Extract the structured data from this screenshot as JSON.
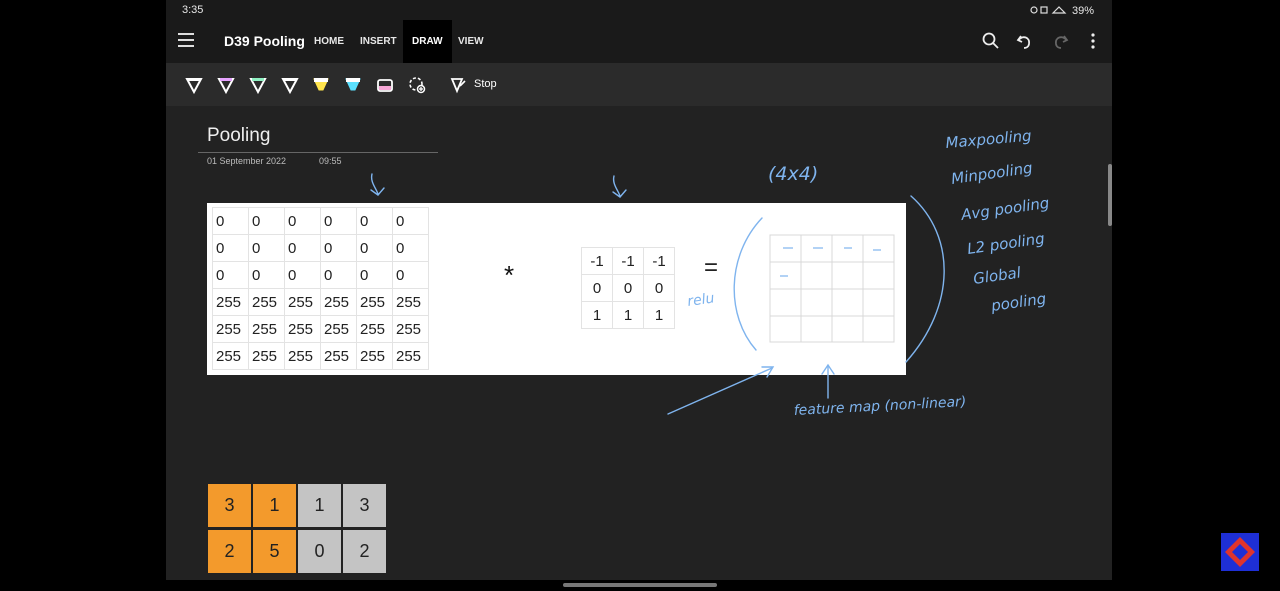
{
  "status_bar": {
    "time": "3:35",
    "battery": "39%"
  },
  "app_bar": {
    "notebook_title": "D39 Pooling",
    "tabs": [
      {
        "label": "HOME"
      },
      {
        "label": "INSERT"
      },
      {
        "label": "DRAW"
      },
      {
        "label": "VIEW"
      }
    ],
    "active_tab": "DRAW"
  },
  "ribbon": {
    "pen_colors": [
      "#ffffff",
      "#e6a3ff",
      "#8ff0c2",
      "#ffffff",
      "#ffe44d",
      "#5ce1ff",
      "#f6a6d6"
    ],
    "stop_label": "Stop"
  },
  "page": {
    "title": "Pooling",
    "date": "01 September 2022",
    "time": "09:55"
  },
  "image_matrix": [
    [
      "0",
      "0",
      "0",
      "0",
      "0",
      "0"
    ],
    [
      "0",
      "0",
      "0",
      "0",
      "0",
      "0"
    ],
    [
      "0",
      "0",
      "0",
      "0",
      "0",
      "0"
    ],
    [
      "255",
      "255",
      "255",
      "255",
      "255",
      "255"
    ],
    [
      "255",
      "255",
      "255",
      "255",
      "255",
      "255"
    ],
    [
      "255",
      "255",
      "255",
      "255",
      "255",
      "255"
    ]
  ],
  "operator": "*",
  "kernel": [
    [
      "-1",
      "-1",
      "-1"
    ],
    [
      "0",
      "0",
      "0"
    ],
    [
      "1",
      "1",
      "1"
    ]
  ],
  "equals": "=",
  "handwriting": {
    "size_note": "(4x4)",
    "relu": "relu",
    "feature_map": "feature map (non-linear)",
    "pooling_types": [
      "Maxpooling",
      "Minpooling",
      "Avg pooling",
      "L2 pooling",
      "Global",
      "pooling"
    ]
  },
  "pool_grid": {
    "cells": [
      {
        "value": "3",
        "color": "#f39a2c"
      },
      {
        "value": "1",
        "color": "#f39a2c"
      },
      {
        "value": "1",
        "color": "#c4c4c4"
      },
      {
        "value": "3",
        "color": "#c4c4c4"
      },
      {
        "value": "2",
        "color": "#f39a2c"
      },
      {
        "value": "5",
        "color": "#f39a2c"
      },
      {
        "value": "0",
        "color": "#c4c4c4"
      },
      {
        "value": "2",
        "color": "#c4c4c4"
      }
    ]
  },
  "colors": {
    "ink_blue": "#7fb4ee",
    "dark_bg": "#222222",
    "accent_orange": "#f39a2c"
  }
}
